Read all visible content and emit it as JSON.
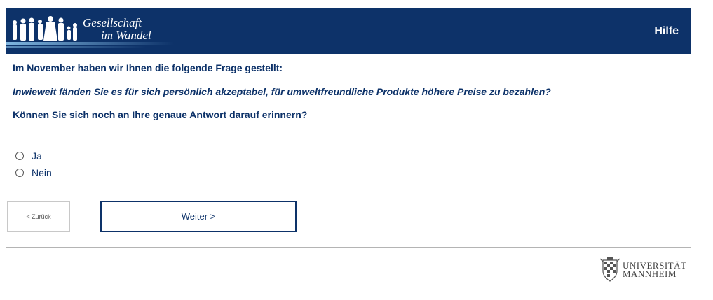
{
  "header": {
    "logo_line1": "Gesellschaft",
    "logo_line2": "im Wandel",
    "help_label": "Hilfe"
  },
  "question": {
    "intro": "Im November haben wir Ihnen die folgende Frage gestellt:",
    "quote": "Inwieweit fänden Sie es für sich persönlich akzeptabel, für umweltfreundliche Produkte höhere Preise zu bezahlen?",
    "prompt": "Können Sie sich noch an Ihre genaue Antwort darauf erinnern?"
  },
  "options": [
    {
      "label": "Ja",
      "selected": false
    },
    {
      "label": "Nein",
      "selected": false
    }
  ],
  "nav": {
    "back_label": "< Zurück",
    "next_label": "Weiter >"
  },
  "footer": {
    "university_line1": "UNIVERSITÄT",
    "university_line2": "MANNHEIM"
  },
  "colors": {
    "brand": "#0d3269",
    "divider": "#b4b4b4"
  }
}
